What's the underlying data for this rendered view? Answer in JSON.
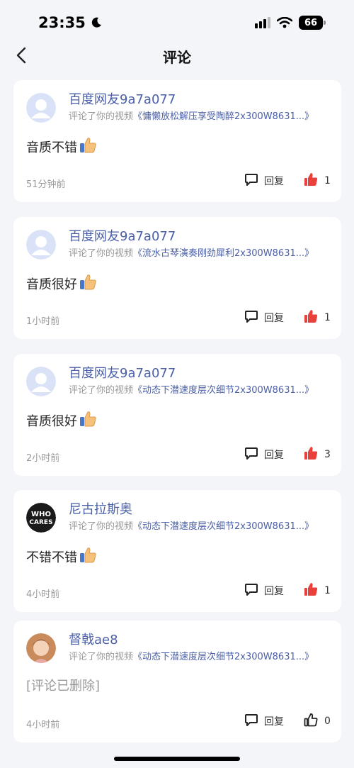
{
  "status": {
    "time": "23:35",
    "battery": "66"
  },
  "header": {
    "title": "评论"
  },
  "labels": {
    "reply": "回复",
    "commented_prefix": "评论了你的视频"
  },
  "comments": [
    {
      "user": "百度网友9a7a077",
      "video": "《慵懒放松解压享受陶醉2x300W8631...》",
      "text": "音质不错",
      "time": "51分钟前",
      "likes": "1",
      "liked": true,
      "avatar": "default"
    },
    {
      "user": "百度网友9a7a077",
      "video": "《流水古琴演奏刚劲犀利2x300W8631...》",
      "text": "音质很好",
      "time": "1小时前",
      "likes": "1",
      "liked": true,
      "avatar": "default"
    },
    {
      "user": "百度网友9a7a077",
      "video": "《动态下潜速度层次细节2x300W8631...》",
      "text": "音质很好",
      "time": "2小时前",
      "likes": "3",
      "liked": true,
      "avatar": "default"
    },
    {
      "user": "尼古拉斯奥",
      "video": "《动态下潜速度层次细节2x300W8631...》",
      "text": "不错不错",
      "time": "4小时前",
      "likes": "1",
      "liked": true,
      "avatar": "who-cares"
    },
    {
      "user": "督戟ae8",
      "video": "《动态下潜速度层次细节2x300W8631...》",
      "text": "[评论已删除]",
      "time": "4小时前",
      "likes": "0",
      "liked": false,
      "avatar": "photo"
    }
  ],
  "colors": {
    "link": "#4a5fa8",
    "liked": "#e8403a",
    "background": "#f4f5f8"
  }
}
